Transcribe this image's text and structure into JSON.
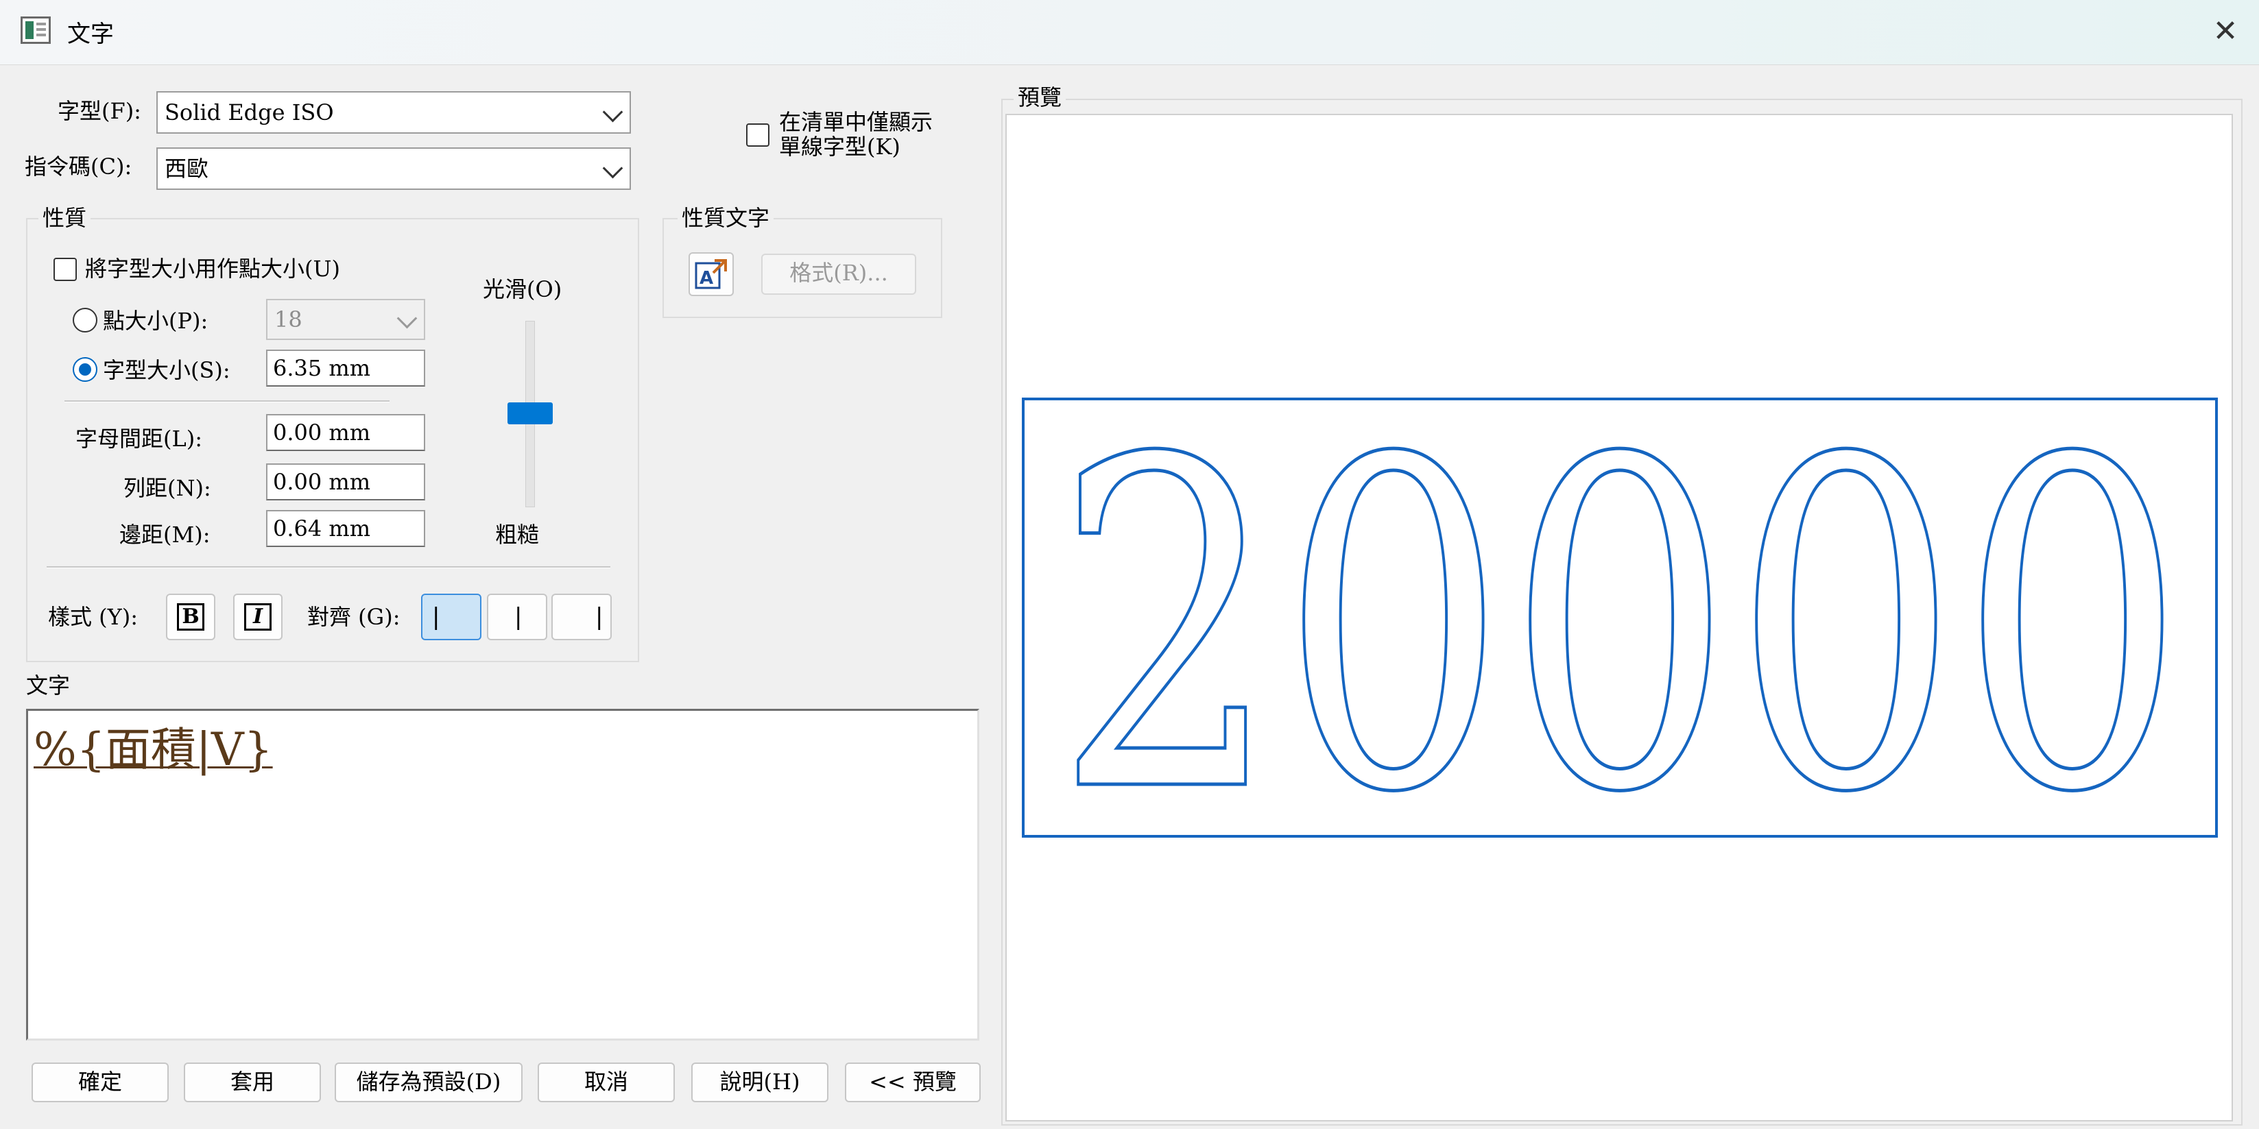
{
  "window": {
    "title": "文字",
    "close_glyph": "✕",
    "icon": "text-dialog-icon"
  },
  "font_row": {
    "label": "字型(F):",
    "value": "Solid Edge ISO"
  },
  "charset_row": {
    "label": "指令碼(C):",
    "value": "西歐"
  },
  "stroke_only": {
    "label_line1": "在清單中僅顯示",
    "label_line2": "單線字型(K)",
    "checked": false
  },
  "properties": {
    "title": "性質",
    "use_font_size_as_point": {
      "label": "將字型大小用作點大小(U)",
      "checked": false
    },
    "point_size": {
      "label": "點大小(P):",
      "value": "18",
      "selected": false
    },
    "font_size": {
      "label": "字型大小(S):",
      "value": "6.35 mm",
      "selected": true
    },
    "letter_spacing": {
      "label": "字母間距(L):",
      "value": "0.00 mm"
    },
    "line_spacing": {
      "label": "列距(N):",
      "value": "0.00 mm"
    },
    "margin": {
      "label": "邊距(M):",
      "value": "0.64 mm"
    },
    "smoothness": {
      "top_label": "光滑(O)",
      "bottom_label": "粗糙",
      "level_fraction": 0.5
    },
    "style_label": "樣式 (Y):",
    "bold_glyph": "B",
    "italic_glyph": "I",
    "align_label": "對齊 (G):",
    "align_glyph": "|"
  },
  "property_text": {
    "title": "性質文字",
    "format_button": "格式(R)..."
  },
  "text_section": {
    "title": "文字",
    "content": "%{面積|V}"
  },
  "preview": {
    "title": "預覽",
    "sample": "20000"
  },
  "buttons": {
    "ok": "確定",
    "apply": "套用",
    "save_default": "儲存為預設(D)",
    "cancel": "取消",
    "help": "說明(H)",
    "preview_toggle": "<< 預覽"
  },
  "colors": {
    "accent": "#0078d4",
    "preview_stroke": "#1565c0"
  }
}
